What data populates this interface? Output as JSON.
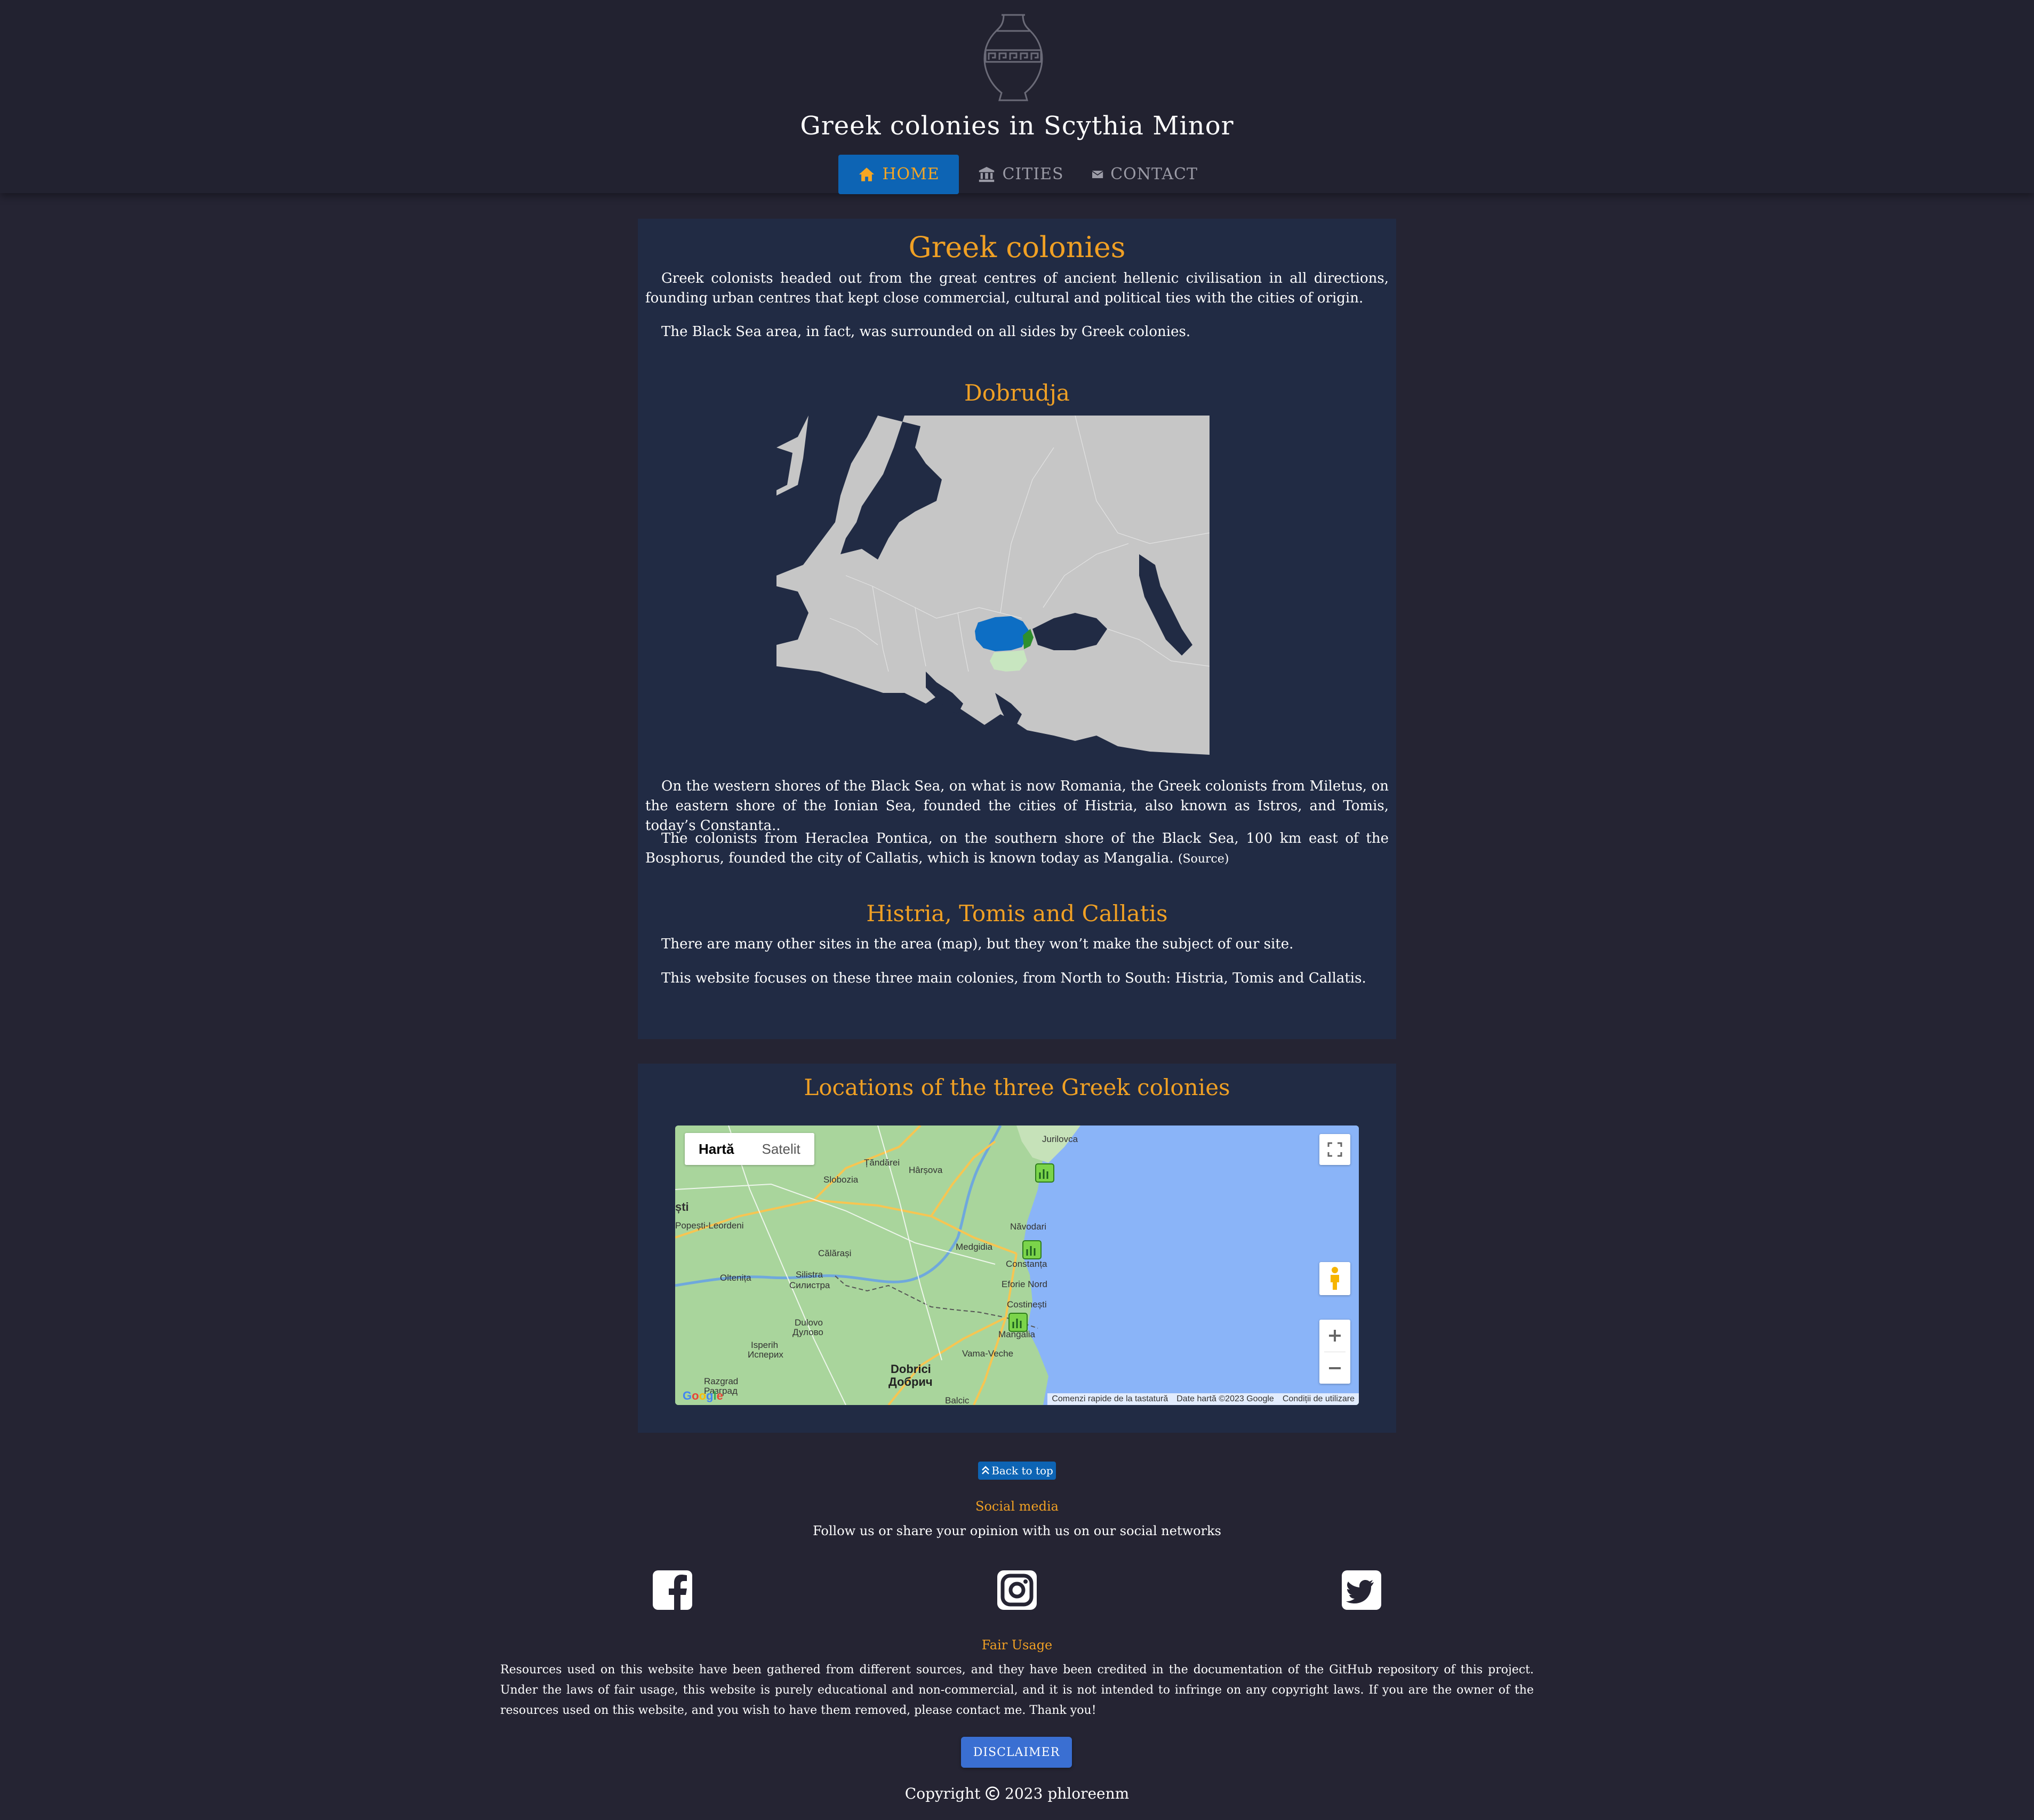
{
  "header": {
    "title": "Greek colonies in Scythia Minor",
    "logo_icon": "greek-vase-icon",
    "nav": [
      {
        "label": "HOME",
        "icon": "home-icon",
        "active": true
      },
      {
        "label": "CITIES",
        "icon": "landmark-icon",
        "active": false
      },
      {
        "label": "CONTACT",
        "icon": "envelope-icon",
        "active": false
      }
    ]
  },
  "intro": {
    "heading": "Greek colonies",
    "p1": "Greek colonists headed out from the great centres of ancient hellenic civilisation in all directions, founding urban centres that kept close commercial, cultural and political ties with the cities of origin.",
    "p2": "The Black Sea area, in fact, was surrounded on all sides by Greek colonies.",
    "subheading": "Dobrudja",
    "p3": "On the western shores of the Black Sea, on what is now Romania, the Greek colonists from Miletus, on the eastern shore of the Ionian Sea, founded the cities of Histria, also known as Istros, and Tomis, today’s Constanta..",
    "p4": "The colonists from Heraclea Pontica, on the southern shore of the Black Sea, 100 km east of the Bosphorus, founded the city of Callatis, which is known today as Mangalia.",
    "source": "(Source)",
    "heading2": "Histria, Tomis and Callatis",
    "p5": "There are many other sites in the area (map), but they won’t make the subject of our site.",
    "p6": "This website focuses on these three main colonies, from North to South: Histria, Tomis and Callatis."
  },
  "map_section": {
    "heading": "Locations of the three Greek colonies",
    "map_type": {
      "map": "Hartă",
      "satellite": "Satelit"
    },
    "labels": {
      "jurilovca": "Jurilovca",
      "tandarei": "Țăndărei",
      "harsova": "Hârșova",
      "slobozia": "Slobozia",
      "popesti": "Popești-Leordeni",
      "sti": "ști",
      "navodari": "Năvodari",
      "medgidia": "Medgidia",
      "calarasi": "Călărași",
      "constanta": "Constanța",
      "oltenita": "Oltenița",
      "silistra": "Silistra",
      "silistra_bg": "Силистра",
      "eforie": "Eforie Nord",
      "costinesti": "Costinești",
      "dulovo": "Dulovo",
      "dulovo_bg": "Дулово",
      "mangalia": "Mangalia",
      "isperih": "Isperih",
      "isperih_bg": "Исперих",
      "vama": "Vama-Veche",
      "dobrich": "Dobrici",
      "dobrich_bg": "Добрич",
      "razgrad": "Razgrad",
      "razgrad_bg": "Разград",
      "balcic": "Balcic"
    },
    "attribution": [
      "Comenzi rapide de la tastatură",
      "Date hartă ©2023 Google",
      "Condiții de utilizare"
    ],
    "google": "Google"
  },
  "footer": {
    "back_to_top": "Back to top",
    "social_heading": "Social media",
    "social_text": "Follow us or share your opinion with us on our social networks",
    "social_icons": [
      "facebook-icon",
      "instagram-icon",
      "twitter-icon"
    ],
    "fair_heading": "Fair Usage",
    "fair_text": "Resources used on this website have been gathered from different sources, and they have been credited in the documentation of the GitHub repository of this project. Under the laws of fair usage, this website is purely educational and non-commercial, and it is not intended to infringe on any copyright laws. If you are the owner of the resources used on this website, and you wish to have them removed, please contact me. Thank you!",
    "disclaimer": "DISCLAIMER",
    "copyright_prefix": "Copyright",
    "copyright_suffix": "2023 phloreenm"
  },
  "colors": {
    "accent": "#f0a024",
    "nav_active": "#0d64b4",
    "section_bg": "#212b44",
    "page_bg": "#252433"
  }
}
